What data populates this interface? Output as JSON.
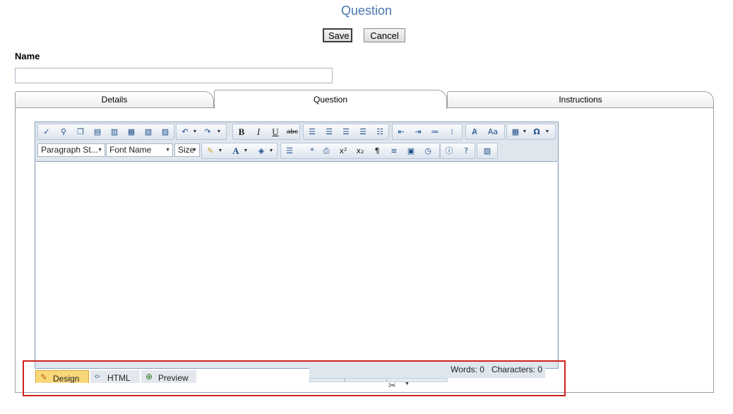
{
  "page": {
    "title": "Question"
  },
  "actions": {
    "save_label": "Save",
    "cancel_label": "Cancel"
  },
  "name_field": {
    "label": "Name",
    "value": ""
  },
  "tabs": [
    {
      "label": "Details",
      "selected": false
    },
    {
      "label": "Question",
      "selected": true
    },
    {
      "label": "Instructions",
      "selected": false
    }
  ],
  "editor": {
    "toolbar_row1": [
      "spellcheck-icon",
      "find-replace-icon",
      "copy-icon",
      "paste-icon",
      "paste-from-word-icon",
      "paste-plain-text-icon",
      "paste-html-icon",
      "paste-as-icon",
      "undo-icon",
      "redo-icon",
      "bold-icon",
      "italic-icon",
      "underline-icon",
      "strikethrough-icon",
      "align-left-icon",
      "align-center-icon",
      "align-right-icon",
      "justify-icon",
      "remove-alignment-icon",
      "outdent-icon",
      "indent-icon",
      "numbered-list-icon",
      "bulleted-list-icon",
      "format-stripper-icon",
      "convert-case-icon",
      "table-icon",
      "special-characters-icon"
    ],
    "toolbar_row2": {
      "paragraph_style": "Paragraph St...",
      "font_name": "Font Name",
      "font_size": "Size",
      "icons": [
        "highlight-icon",
        "font-color-icon",
        "background-color-icon",
        "align-paragraph-icon",
        "asterisk-icon",
        "print-icon",
        "superscript-icon",
        "subscript-icon",
        "paragraph-mark-icon",
        "horizontal-rule-icon",
        "document-icon",
        "clock-icon",
        "info-icon",
        "help-icon",
        "image-manager-icon"
      ]
    },
    "content": "",
    "modes": [
      {
        "label": "Design",
        "icon": "pencil-icon",
        "active": true
      },
      {
        "label": "HTML",
        "icon": "html-tags-icon",
        "active": false
      },
      {
        "label": "Preview",
        "icon": "magnifier-icon",
        "active": false
      }
    ],
    "stats": {
      "words_label": "Words: 0",
      "characters_label": "Characters: 0"
    }
  },
  "colors": {
    "title": "#4a78b0",
    "active_mode_tab": "#f9d87a",
    "highlight_border": "#d0201f",
    "toolbar_border": "#b8c6d8"
  }
}
